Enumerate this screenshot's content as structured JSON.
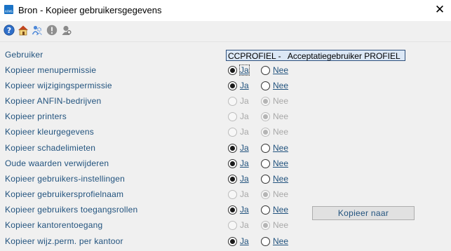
{
  "window": {
    "title": "Bron - Kopieer gebruikersgegevens",
    "app_icon_text": "AFMS",
    "close_glyph": "✕"
  },
  "toolbar": {
    "icons": [
      "help-icon",
      "home-icon",
      "users-icon",
      "info-icon",
      "user-search-icon"
    ]
  },
  "user": {
    "label": "Gebruiker",
    "value": "CCPROFIEL -   Acceptatiegebruiker PROFIEL"
  },
  "options": [
    {
      "label": "Kopieer menupermissie",
      "yes": "Ja",
      "no": "Nee",
      "selected": "Ja",
      "enabled": true
    },
    {
      "label": "Kopieer wijzigingspermissie",
      "yes": "Ja",
      "no": "Nee",
      "selected": "Ja",
      "enabled": true
    },
    {
      "label": "Kopieer ANFIN-bedrijven",
      "yes": "Ja",
      "no": "Nee",
      "selected": "Nee",
      "enabled": false
    },
    {
      "label": "Kopieer printers",
      "yes": "Ja",
      "no": "Nee",
      "selected": "Nee",
      "enabled": false
    },
    {
      "label": "Kopieer kleurgegevens",
      "yes": "Ja",
      "no": "Nee",
      "selected": "Nee",
      "enabled": false
    },
    {
      "label": "Kopieer schadelimieten",
      "yes": "Ja",
      "no": "Nee",
      "selected": "Ja",
      "enabled": true
    },
    {
      "label": "Oude waarden verwijderen",
      "yes": "Ja",
      "no": "Nee",
      "selected": "Ja",
      "enabled": true
    },
    {
      "label": "Kopieer gebruikers-instellingen",
      "yes": "Ja",
      "no": "Nee",
      "selected": "Ja",
      "enabled": true
    },
    {
      "label": "Kopieer gebruikersprofielnaam",
      "yes": "Ja",
      "no": "Nee",
      "selected": "Nee",
      "enabled": false
    },
    {
      "label": "Kopieer gebruikers toegangsrollen",
      "yes": "Ja",
      "no": "Nee",
      "selected": "Ja",
      "enabled": true
    },
    {
      "label": "Kopieer kantorentoegang",
      "yes": "Ja",
      "no": "Nee",
      "selected": "Nee",
      "enabled": false
    },
    {
      "label": "Kopieer wijz.perm. per kantoor",
      "yes": "Ja",
      "no": "Nee",
      "selected": "Ja",
      "enabled": true
    }
  ],
  "copy_button": {
    "label": "Kopieer naar"
  },
  "colors": {
    "label_blue": "#22537e",
    "field_bg": "#dce8f6",
    "window_bg": "#f0f0f0"
  }
}
